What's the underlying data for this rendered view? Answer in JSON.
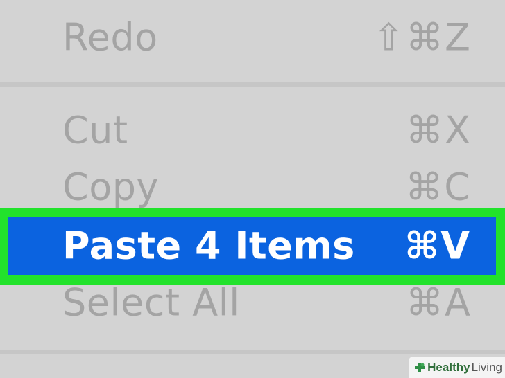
{
  "menu": {
    "items": [
      {
        "label": "Redo",
        "shortcut": "⇧⌘Z",
        "enabled": false
      },
      {
        "label": "Cut",
        "shortcut": "⌘X",
        "enabled": false
      },
      {
        "label": "Copy",
        "shortcut": "⌘C",
        "enabled": false
      },
      {
        "label": "Paste 4 Items",
        "shortcut": "⌘V",
        "enabled": true,
        "highlighted": true
      },
      {
        "label": "Select All",
        "shortcut": "⌘A",
        "enabled": false
      }
    ]
  },
  "watermark": {
    "brand_bold": "Healthy",
    "brand_regular": "Living"
  },
  "colors": {
    "menu_bg": "#d3d3d3",
    "disabled_text": "#a4a4a4",
    "highlight_bg": "#0b63e0",
    "highlight_frame": "#22e22b",
    "highlight_text": "#ffffff"
  }
}
